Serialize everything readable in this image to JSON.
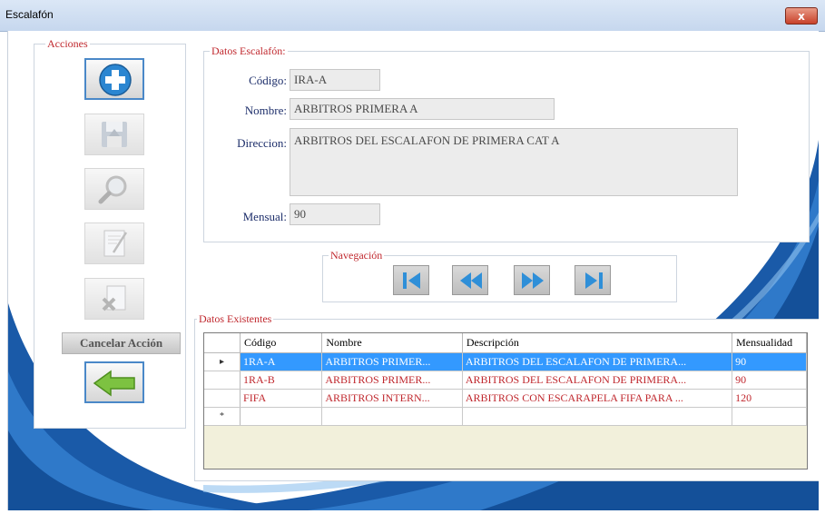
{
  "window": {
    "title": "Escalafón",
    "close_label": "x"
  },
  "acciones": {
    "legend": "Acciones",
    "buttons": [
      {
        "icon": "add-icon",
        "state": "active"
      },
      {
        "icon": "save-icon",
        "state": "disabled"
      },
      {
        "icon": "search-icon",
        "state": "disabled"
      },
      {
        "icon": "edit-icon",
        "state": "disabled"
      },
      {
        "icon": "delete-icon",
        "state": "disabled"
      }
    ],
    "cancel_label": "Cancelar Acción",
    "exit_icon": "back-arrow-icon"
  },
  "datos": {
    "legend": "Datos Escalafón:",
    "codigo_label": "Código:",
    "codigo_value": "IRA-A",
    "nombre_label": "Nombre:",
    "nombre_value": "ARBITROS PRIMERA A",
    "direccion_label": "Direccion:",
    "direccion_value": "ARBITROS DEL ESCALAFON DE PRIMERA CAT A",
    "mensual_label": "Mensual:",
    "mensual_value": "90"
  },
  "navegacion": {
    "legend": "Navegación",
    "buttons": [
      "first-record-icon",
      "previous-record-icon",
      "next-record-icon",
      "last-record-icon"
    ]
  },
  "existentes": {
    "legend": "Datos Existentes",
    "columns": [
      "Código",
      "Nombre",
      "Descripción",
      "Mensualidad"
    ],
    "rows": [
      {
        "indicator": "▸",
        "codigo": "1RA-A",
        "nombre": "ARBITROS PRIMER...",
        "descripcion": "ARBITROS DEL ESCALAFON DE PRIMERA...",
        "mensualidad": "90",
        "selected": true
      },
      {
        "indicator": "",
        "codigo": "1RA-B",
        "nombre": "ARBITROS PRIMER...",
        "descripcion": "ARBITROS DEL ESCALAFON DE PRIMERA...",
        "mensualidad": "90",
        "selected": false
      },
      {
        "indicator": "",
        "codigo": "FIFA",
        "nombre": "ARBITROS INTERN...",
        "descripcion": "ARBITROS CON ESCARAPELA FIFA PARA ...",
        "mensualidad": "120",
        "selected": false
      }
    ],
    "new_row_indicator": "*"
  },
  "colors": {
    "accent_blue": "#1a5aa8",
    "legend_red": "#c0282e",
    "label_navy": "#1e2f6b",
    "selection": "#3399ff"
  }
}
